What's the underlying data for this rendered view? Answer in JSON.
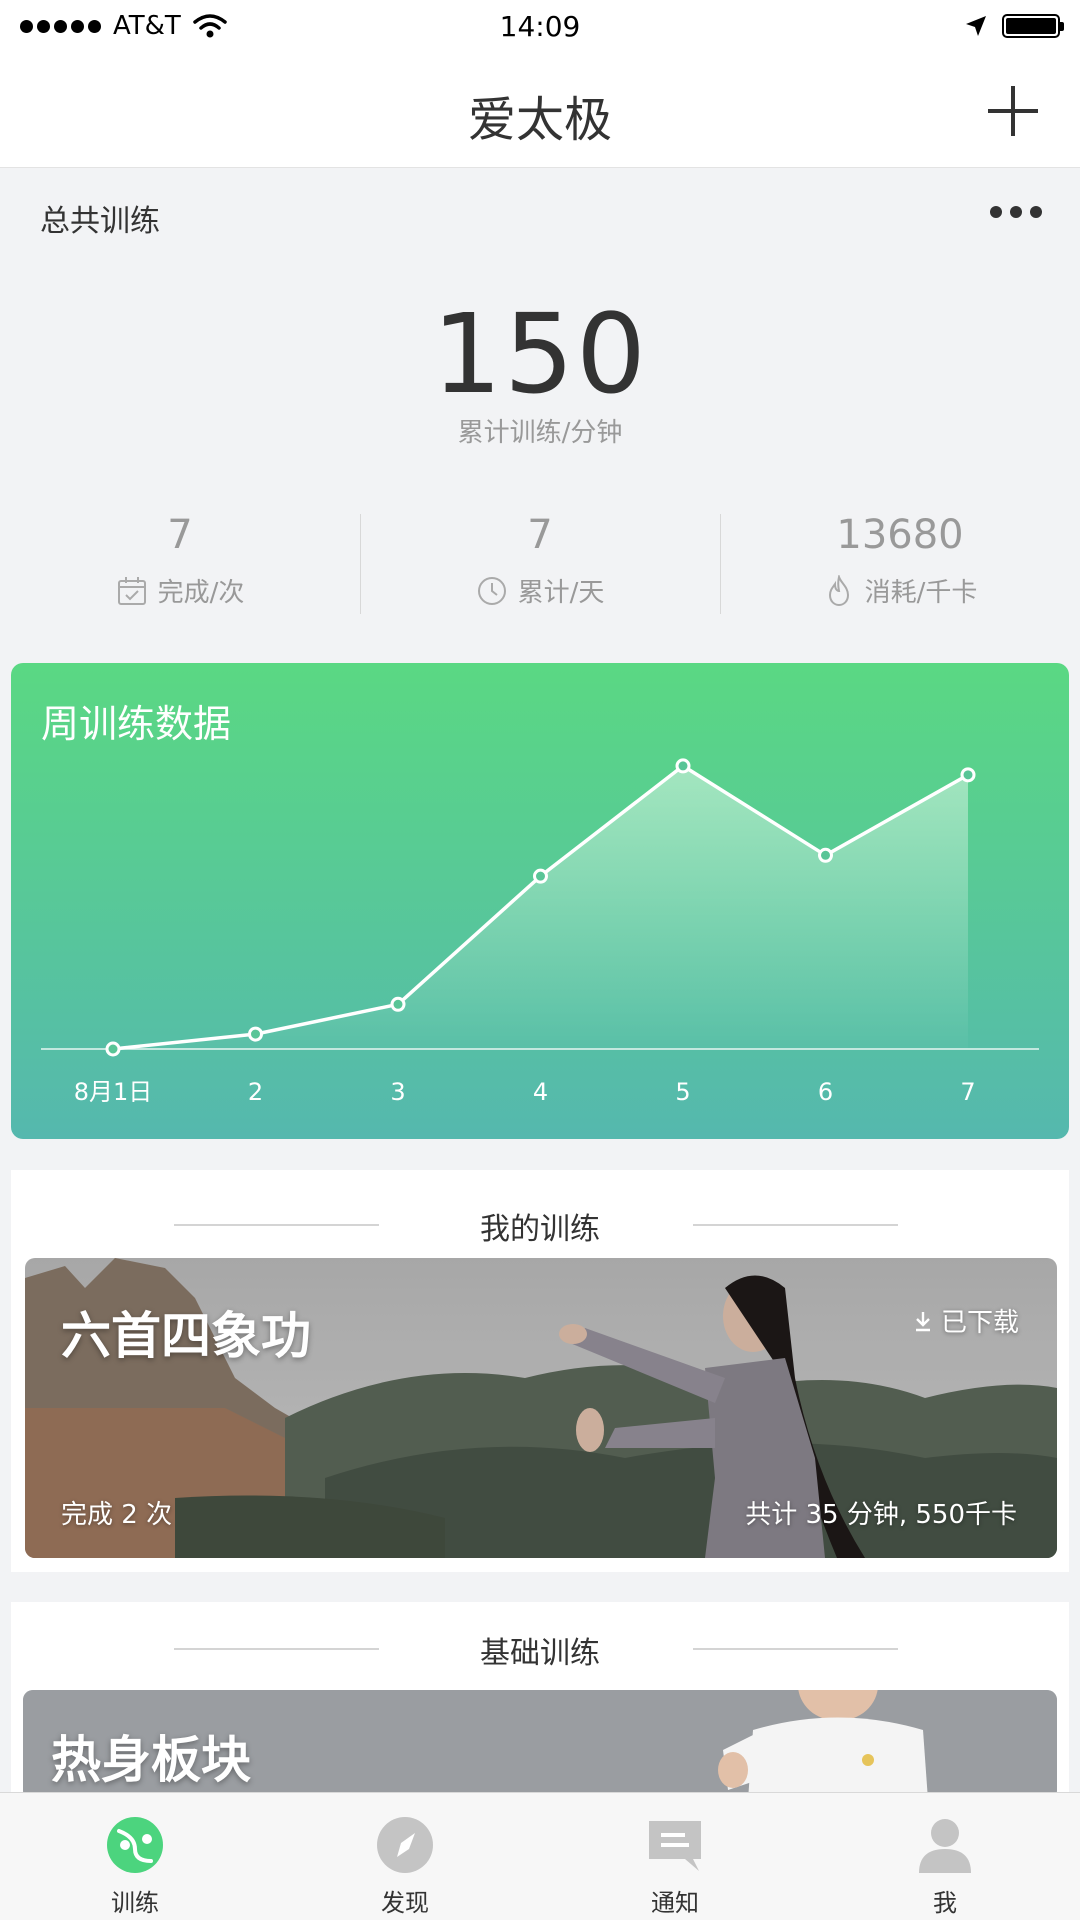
{
  "status_bar": {
    "carrier": "AT&T",
    "time": "14:09"
  },
  "nav": {
    "title": "爱太极"
  },
  "summary": {
    "label": "总共训练",
    "total_value": "150",
    "total_caption": "累计训练/分钟",
    "stats": [
      {
        "value": "7",
        "label": "完成/次",
        "icon": "calendar-icon"
      },
      {
        "value": "7",
        "label": "累计/天",
        "icon": "clock-icon"
      },
      {
        "value": "13680",
        "label": "消耗/千卡",
        "icon": "flame-icon"
      }
    ]
  },
  "chart_data": {
    "type": "area",
    "title": "周训练数据",
    "categories": [
      "8月1日",
      "2",
      "3",
      "4",
      "5",
      "6",
      "7"
    ],
    "values": [
      0,
      5,
      15,
      58,
      95,
      65,
      92
    ],
    "xlabel": "",
    "ylabel": "",
    "ylim": [
      0,
      100
    ],
    "grid": false,
    "colors": {
      "line": "#ffffff",
      "bg_top": "#5ad883",
      "bg_bottom": "#55b8ae"
    }
  },
  "my_training": {
    "title": "我的训练",
    "course": {
      "name": "六首四象功",
      "download_status": "已下载",
      "completed": "完成 2 次",
      "totals": "共计 35 分钟, 550千卡"
    }
  },
  "basic_training": {
    "title": "基础训练",
    "course": {
      "name": "热身板块"
    }
  },
  "tab_bar": {
    "items": [
      {
        "label": "训练",
        "icon": "taiji-icon",
        "active": true
      },
      {
        "label": "发现",
        "icon": "compass-icon",
        "active": false
      },
      {
        "label": "通知",
        "icon": "message-icon",
        "active": false
      },
      {
        "label": "我",
        "icon": "person-icon",
        "active": false
      }
    ],
    "active_color": "#4cd47e",
    "inactive_color": "#c4c4c4"
  }
}
